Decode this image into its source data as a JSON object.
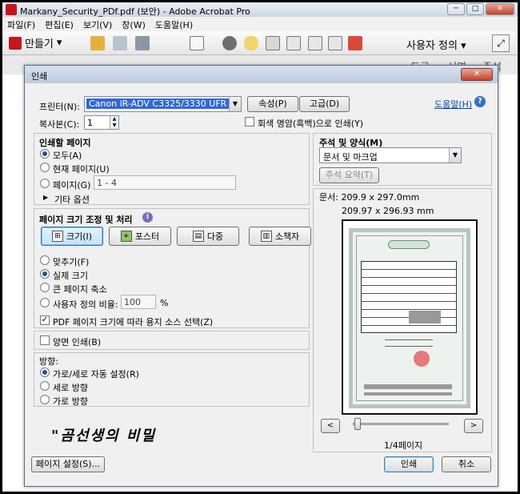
{
  "window": {
    "title": "Markany_Security_PDf.pdf (보안) - Adobe Acrobat Pro",
    "minimize": "─",
    "maximize": "□",
    "close": "✕"
  },
  "menubar": {
    "items": [
      "파일(F)",
      "편집(E)",
      "보기(V)",
      "창(W)",
      "도움말(H)"
    ]
  },
  "toolbar": {
    "create_label": "만들기",
    "create_arrow": "▾",
    "user_defined_label": "사용자 정의",
    "user_defined_arrow": "▾",
    "expand_glyph": "⤢",
    "icons": [
      "open-folder-icon",
      "save-icon",
      "print-icon",
      "email-icon",
      "gear-icon",
      "comment-icon",
      "sign-icon",
      "secure-document-icon",
      "edit-pdf-icon"
    ]
  },
  "toolbar2": {
    "tools": "도구",
    "sign": "서명",
    "comment": "주석"
  },
  "dialog": {
    "title": "인쇄",
    "close": "✕",
    "printer_label": "프린터(N):",
    "printer_value": "Canon iR-ADV C3325/3330 UFR II",
    "properties_button": "속성(P)",
    "advanced_button": "고급(D)",
    "help_link": "도움말(H)",
    "help_icon": "?",
    "copies_label": "복사본(C):",
    "copies_value": "1",
    "grayscale_label": "회색 명암(흑백)으로 인쇄(Y)",
    "pages_section": {
      "title": "인쇄할 페이지",
      "all": "모두(A)",
      "current": "현재 페이지(U)",
      "pages": "페이지(G)",
      "pages_value": "1 - 4",
      "more_options": "기타 옵션",
      "expander": "▶"
    },
    "sizing_section": {
      "title": "페이지 크기 조정 및 처리",
      "info_icon": "i",
      "buttons": [
        "크기(I)",
        "포스터",
        "다중",
        "소책자"
      ],
      "fit": "맞추기(F)",
      "actual_size": "실제 크기",
      "shrink": "큰 페이지 축소",
      "custom_scale": "사용자 정의 비율:",
      "custom_scale_value": "100",
      "percent": "%",
      "choose_paper": "PDF 페이지 크기에 따라 용지 소스 선택(Z)"
    },
    "duplex_label": "양면 인쇄(B)",
    "orientation_section": {
      "title": "방향:",
      "auto": "가로/세로 자동 설정(R)",
      "portrait": "세로 방향",
      "landscape": "가로 방향"
    },
    "annotations_section": {
      "title": "주석 및 양식(M)",
      "value": "문서 및 마크업",
      "summarize_button": "주석 요약(T)"
    },
    "preview": {
      "doc_size": "문서: 209.9 x 297.0mm",
      "paper_size": "209.97 x 296.93 mm",
      "page_indicator": "1/4페이지",
      "prev": "<",
      "next": ">"
    },
    "page_setup_button": "페이지 설정(S)...",
    "print_button": "인쇄",
    "cancel_button": "취소"
  },
  "watermark_text": "\"곰선생의 비밀",
  "check_mark": "✓",
  "colors": {
    "accent": "#3368d2",
    "link": "#0645ad",
    "close_red": "#c5422a",
    "help_blue": "#2f72c8"
  }
}
